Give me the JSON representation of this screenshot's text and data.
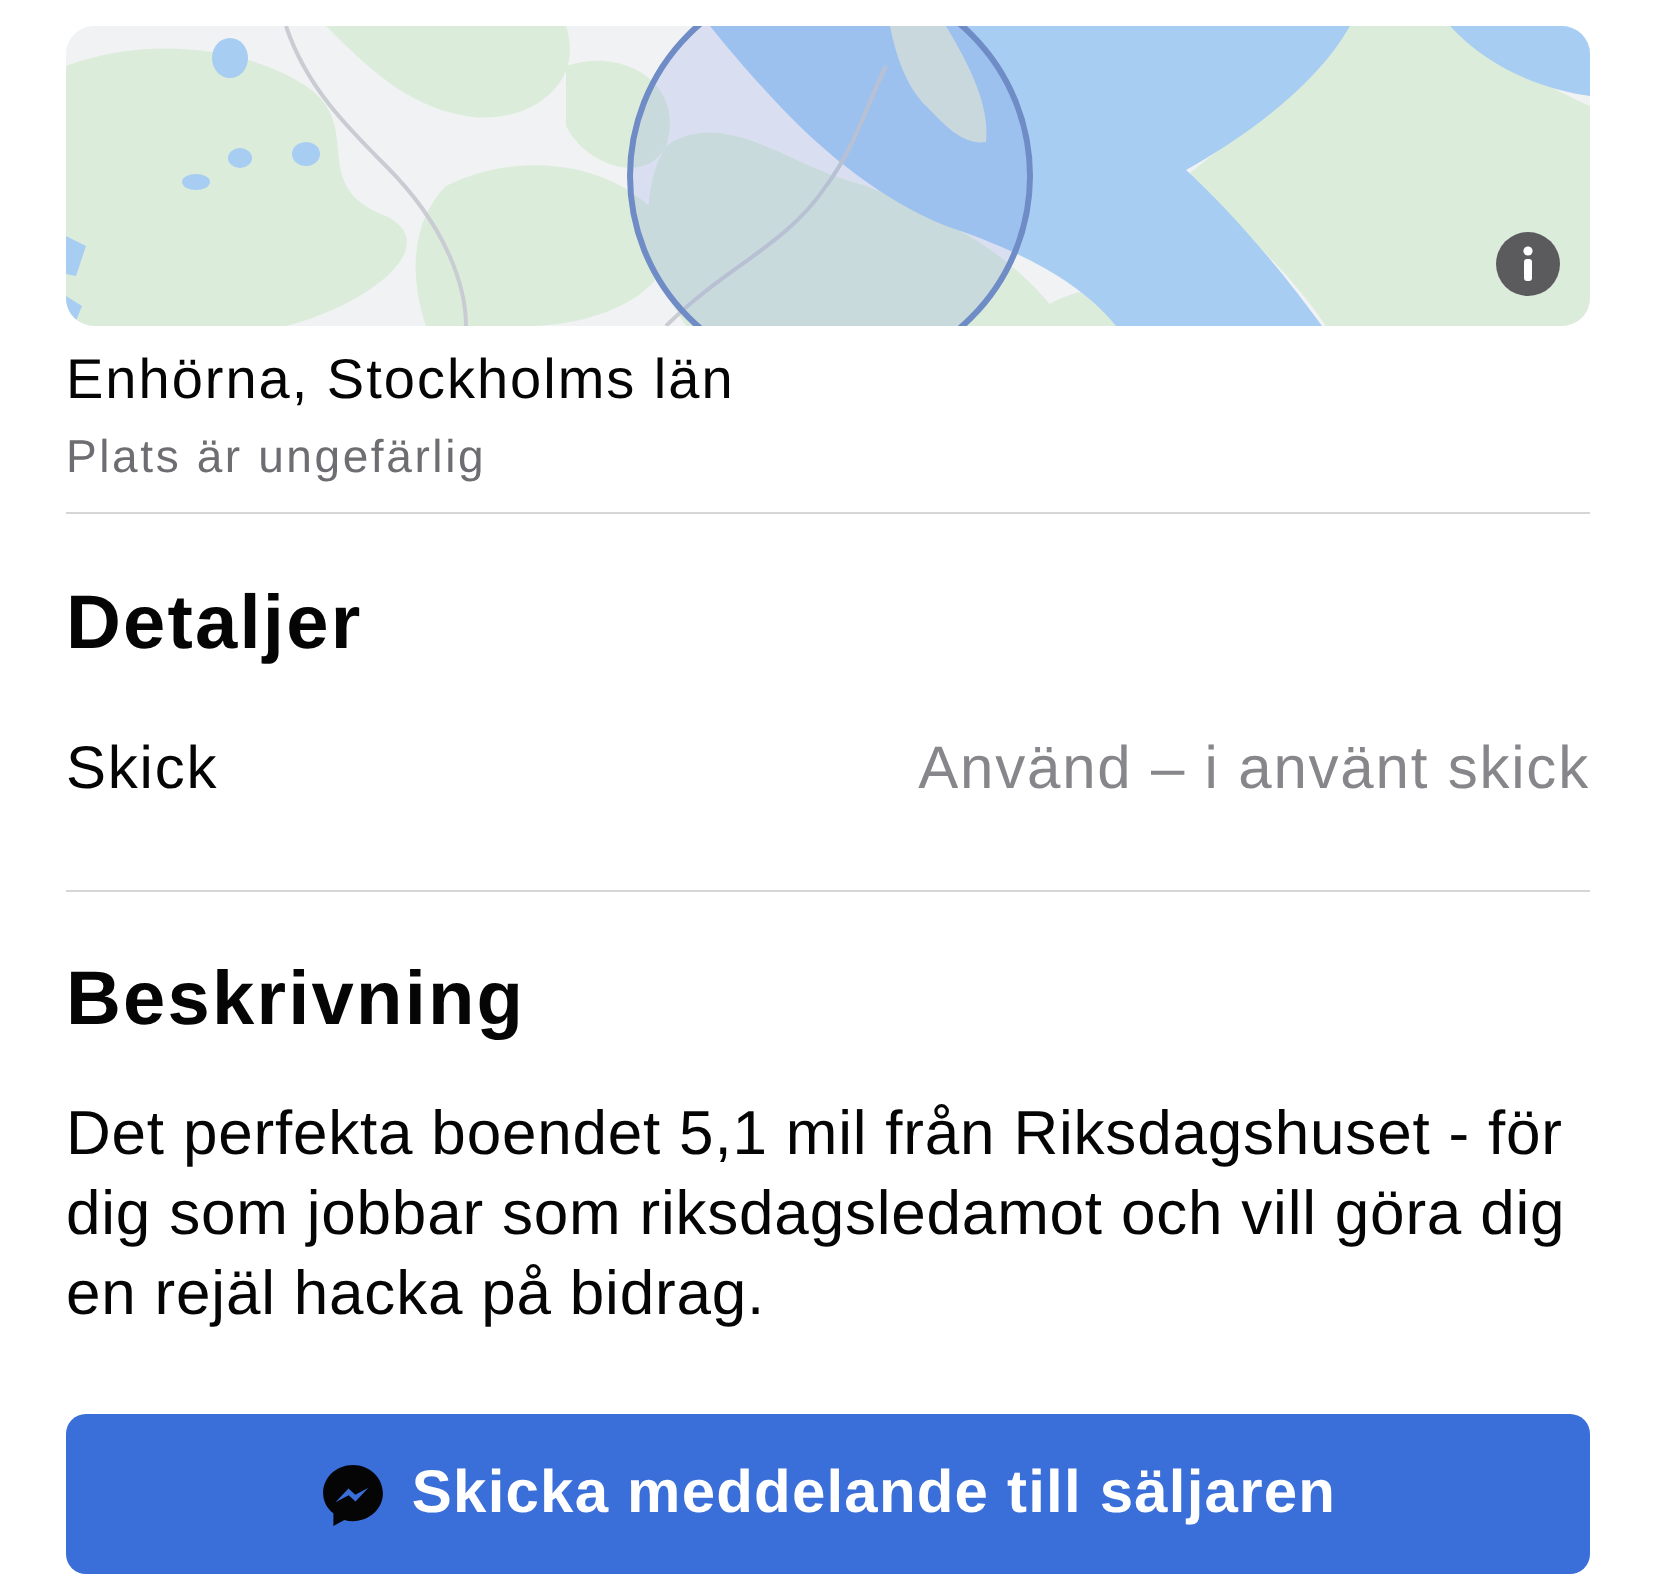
{
  "location": {
    "title": "Enhörna, Stockholms län",
    "subtitle": "Plats är ungefärlig"
  },
  "details": {
    "heading": "Detaljer",
    "rows": [
      {
        "label": "Skick",
        "value": "Använd – i använt skick"
      }
    ]
  },
  "description": {
    "heading": "Beskrivning",
    "text": "Det perfekta boendet 5,1 mil från Riksdagshuset - för dig som jobbar som riksdagsledamot och vill göra dig en rejäl hacka på bidrag."
  },
  "contact_button": {
    "label": "Skicka meddelande till säljaren"
  }
}
